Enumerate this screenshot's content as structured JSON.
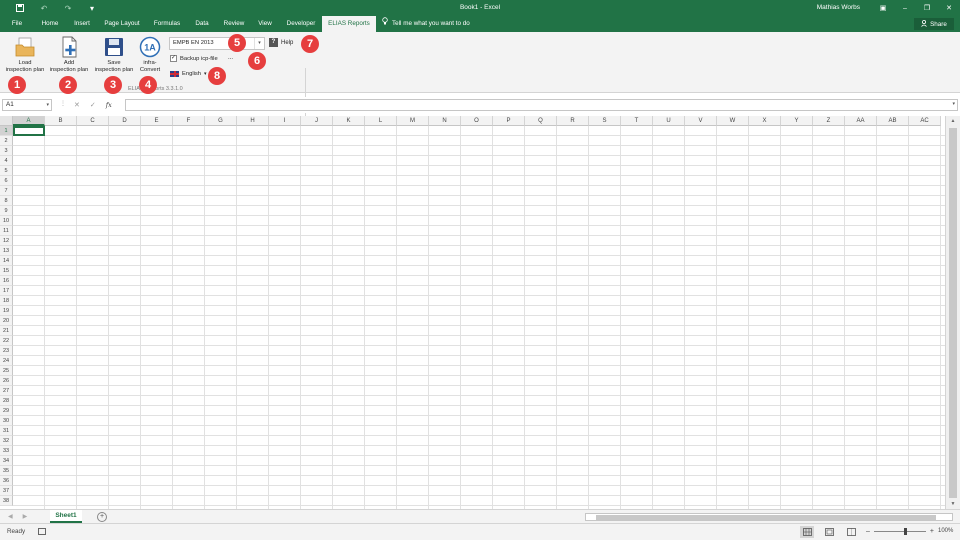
{
  "app": {
    "document_title": "Book1 - Excel",
    "user_name": "Mathias Worbs",
    "share_label": "Share"
  },
  "tabs": [
    "File",
    "Home",
    "Insert",
    "Page Layout",
    "Formulas",
    "Data",
    "Review",
    "View",
    "Developer",
    "ELIAS Reports"
  ],
  "active_tab": "ELIAS Reports",
  "tell_me": "Tell me what you want to do",
  "ribbon": {
    "load_line1": "Load",
    "load_line2": "inspection plan",
    "add_line1": "Add",
    "add_line2": "inspection plan",
    "save_line1": "Save",
    "save_line2": "inspection plan",
    "convert_line1": "infra-",
    "convert_line2": "Convert",
    "standard_value": "EMPB EN 2013",
    "help_label": "Help",
    "backup_label": "Backup icp-file",
    "backup_checked": true,
    "browse_label": "...",
    "language_label": "English",
    "group_label": "ELIAS Reports 3.3.1.0"
  },
  "badges": [
    "1",
    "2",
    "3",
    "4",
    "5",
    "6",
    "7",
    "8"
  ],
  "formula_bar": {
    "name_box": "A1",
    "fx_label": "fx",
    "value": ""
  },
  "grid": {
    "columns": [
      "A",
      "B",
      "C",
      "D",
      "E",
      "F",
      "G",
      "H",
      "I",
      "J",
      "K",
      "L",
      "M",
      "N",
      "O",
      "P",
      "Q",
      "R",
      "S",
      "T",
      "U",
      "V",
      "W",
      "X",
      "Y",
      "Z",
      "AA",
      "AB",
      "AC"
    ],
    "rows": [
      "1",
      "2",
      "3",
      "4",
      "5",
      "6",
      "7",
      "8",
      "9",
      "10",
      "11",
      "12",
      "13",
      "14",
      "15",
      "16",
      "17",
      "18",
      "19",
      "20",
      "21",
      "22",
      "23",
      "24",
      "25",
      "26",
      "27",
      "28",
      "29",
      "30",
      "31",
      "32",
      "33",
      "34",
      "35",
      "36",
      "37",
      "38"
    ],
    "active_cell": "A1"
  },
  "sheets": [
    "Sheet1"
  ],
  "status": {
    "ready": "Ready",
    "zoom": "100%"
  },
  "colors": {
    "accent": "#217346",
    "badge": "#e63e3e"
  }
}
